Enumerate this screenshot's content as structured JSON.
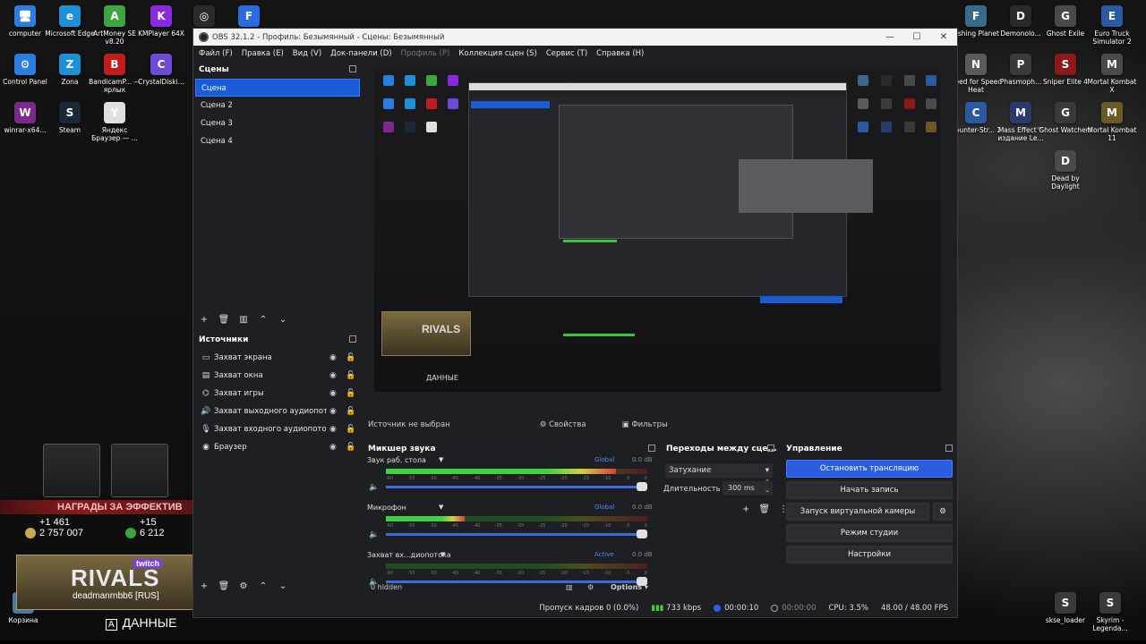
{
  "desktop": {
    "left_icons": [
      {
        "label": "computer",
        "color": "#2b7de0",
        "glyph": "🖥"
      },
      {
        "label": "Microsoft Edge",
        "color": "#1f8fd6",
        "glyph": "e"
      },
      {
        "label": "ArtMoney SE v8.20",
        "color": "#3fa63f",
        "glyph": "A"
      },
      {
        "label": "KMPlayer 64X",
        "color": "#8a2ae0",
        "glyph": "K"
      },
      {
        "label": "Control Panel",
        "color": "#2b7de0",
        "glyph": "⚙"
      },
      {
        "label": "Zona",
        "color": "#1f8fd6",
        "glyph": "Z"
      },
      {
        "label": "BandicamP... — ярлык",
        "color": "#c01c1c",
        "glyph": "B"
      },
      {
        "label": "CrystalDiski...",
        "color": "#6b4bd6",
        "glyph": "C"
      },
      {
        "label": "winrar-x64...",
        "color": "#7a2a8a",
        "glyph": "W"
      },
      {
        "label": "Steam",
        "color": "#1b2838",
        "glyph": "S"
      },
      {
        "label": "Яндекс Браузер — ...",
        "color": "#e0e0e0",
        "glyph": "Y"
      }
    ],
    "top_icons": [
      {
        "color": "#2a2a2a",
        "glyph": "◎"
      },
      {
        "color": "#2b6be0",
        "glyph": "F"
      }
    ],
    "right_icons": [
      {
        "label": "Fishing Planet",
        "color": "#3a6a8a",
        "glyph": "F"
      },
      {
        "label": "Demonolo...",
        "color": "#2a2a2a",
        "glyph": "D"
      },
      {
        "label": "Ghost Exile",
        "color": "#4a4a4a",
        "glyph": "G"
      },
      {
        "label": "Euro Truck Simulator 2",
        "color": "#2b5aa0",
        "glyph": "E"
      },
      {
        "label": "Need for Speed Heat",
        "color": "#5a5a5a",
        "glyph": "N"
      },
      {
        "label": "Phasmoph...",
        "color": "#3a3a3a",
        "glyph": "P"
      },
      {
        "label": "Sniper Elite 4",
        "color": "#8a1a1a",
        "glyph": "S"
      },
      {
        "label": "Mortal Kombat X",
        "color": "#4a4a4a",
        "glyph": "M"
      },
      {
        "label": "Counter-Str... 2",
        "color": "#2b5aa0",
        "glyph": "C"
      },
      {
        "label": "Mass Effect™ издание Le...",
        "color": "#2a3a6a",
        "glyph": "M"
      },
      {
        "label": "Ghost Watchers",
        "color": "#3a3a3a",
        "glyph": "G"
      },
      {
        "label": "Mortal Kombat 11",
        "color": "#6a5a2a",
        "glyph": "M"
      },
      {
        "label": "Dead by Daylight",
        "color": "#4a4a4a",
        "glyph": "D"
      }
    ],
    "bottom_left_icon": {
      "label": "Корзина",
      "color": "#4a7aa0",
      "glyph": "🗑"
    },
    "bottom_right_icons": [
      {
        "label": "skse_loader",
        "color": "#3a3a3a",
        "glyph": "S"
      },
      {
        "label": "Skyrim - Legenda...",
        "color": "#3a3a3a",
        "glyph": "S"
      }
    ]
  },
  "overlay": {
    "banner": "НАГРАДЫ ЗА ЭФФЕКТИВ",
    "stat1_top": "+1 461",
    "stat1_bottom": "2 757 007",
    "stat2_top": "+15",
    "stat2_bottom": "6 212",
    "card_brand": "twitch",
    "card_title": "RIVALS",
    "card_user": "deadmanrnbb6 [RUS]",
    "data_key": "A",
    "data_label": "ДАННЫЕ"
  },
  "obs": {
    "title": "OBS 32.1.2 - Профиль: Безымянный - Сцены: Безымянный",
    "menu": [
      {
        "label": "Файл (F)",
        "dim": false
      },
      {
        "label": "Правка (E)",
        "dim": false
      },
      {
        "label": "Вид (V)",
        "dim": false
      },
      {
        "label": "Док-панели (D)",
        "dim": false
      },
      {
        "label": "Профиль (P)",
        "dim": true
      },
      {
        "label": "Коллекция сцен (S)",
        "dim": false
      },
      {
        "label": "Сервис (T)",
        "dim": false
      },
      {
        "label": "Справка (H)",
        "dim": false
      }
    ],
    "scenes_title": "Сцены",
    "scenes": [
      "Сцена",
      "Сцена 2",
      "Сцена 3",
      "Сцена 4"
    ],
    "selected_scene": 0,
    "sources_title": "Источники",
    "sources": [
      {
        "label": "Захват экрана",
        "icon": "▭"
      },
      {
        "label": "Захват окна",
        "icon": "▤"
      },
      {
        "label": "Захват игры",
        "icon": "⌬"
      },
      {
        "label": "Захват выходного аудиопотока",
        "icon": "🔊"
      },
      {
        "label": "Захват входного аудиопотока",
        "icon": "🎙"
      },
      {
        "label": "Браузер",
        "icon": "◉"
      }
    ],
    "no_source": "Источник не выбран",
    "properties_label": "Свойства",
    "filters_label": "Фильтры",
    "preview_card_text": "RIVALS",
    "preview_data_text": "ДАННЫЕ",
    "mixer_title": "Микшер звука",
    "mixer": [
      {
        "name": "Звук раб. стола",
        "tag": "Global",
        "db": "0.0 dB",
        "level": 0.88,
        "volume": 1.0
      },
      {
        "name": "Микрофон",
        "tag": "Global",
        "db": "0.0 dB",
        "level": 0.3,
        "volume": 1.0
      },
      {
        "name": "Захват вх...диопотока",
        "tag": "Active",
        "db": "0.0 dB",
        "level": 0.0,
        "volume": 1.0
      }
    ],
    "mixer_ticks": [
      "-60",
      "-55",
      "-50",
      "-45",
      "-40",
      "-35",
      "-30",
      "-25",
      "-20",
      "-15",
      "-10",
      "-5",
      "0"
    ],
    "hidden_count": "0 hidden",
    "options_label": "Options",
    "transitions_title": "Переходы между сце...",
    "transition": "Затухание",
    "duration_label": "Длительность",
    "duration_value": "300 ms",
    "controls_title": "Управление",
    "controls": {
      "stop_stream": "Остановить трансляцию",
      "start_record": "Начать запись",
      "virtual_cam": "Запуск виртуальной камеры",
      "studio_mode": "Режим студии",
      "settings": "Настройки"
    },
    "status": {
      "dropped": "Пропуск кадров 0 (0.0%)",
      "bitrate": "733 kbps",
      "stream_time": "00:00:10",
      "rec_time": "00:00:00",
      "cpu": "CPU: 3.5%",
      "fps": "48.00 / 48.00 FPS"
    }
  },
  "colors": {
    "accent": "#2a5de0",
    "selected_scene": "#1a5bd8",
    "window_bg": "#1e1f23",
    "meter_green": "#3fd13f"
  }
}
